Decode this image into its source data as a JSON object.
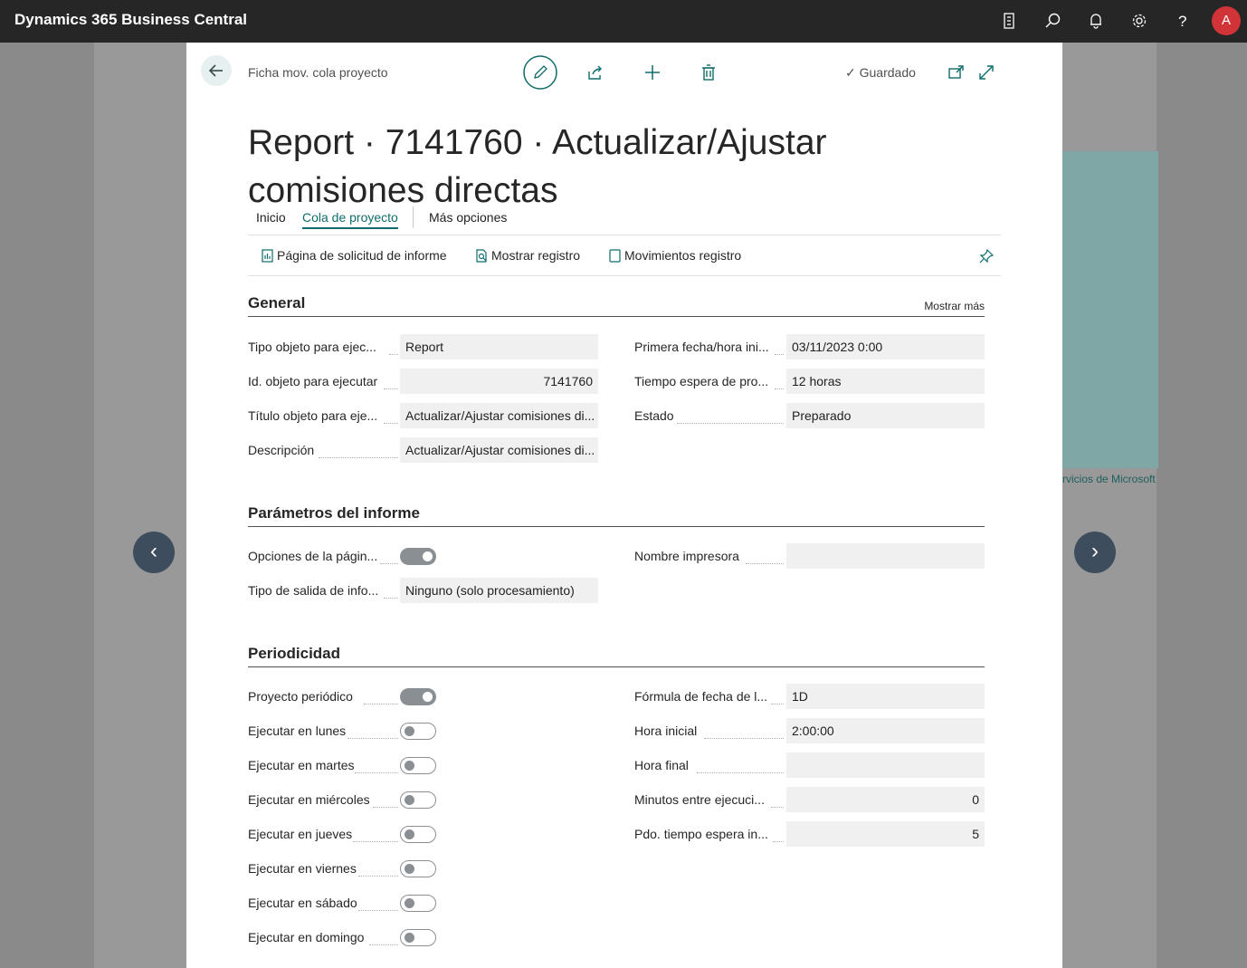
{
  "app": {
    "title": "Dynamics 365 Business Central",
    "avatar_initial": "A"
  },
  "background": {
    "attribution": "rvicios de Microsoft"
  },
  "dialog": {
    "breadcrumb": "Ficha mov. cola proyecto",
    "saved_label": "Guardado",
    "title": "Report · 7141760 · Actualizar/Ajustar comisiones directas",
    "tabs": [
      "Inicio",
      "Cola de proyecto",
      "Más opciones"
    ],
    "active_tab": "Cola de proyecto",
    "actions": [
      "Página de solicitud de informe",
      "Mostrar registro",
      "Movimientos registro"
    ]
  },
  "general": {
    "heading": "General",
    "show_more": "Mostrar más",
    "left": [
      {
        "label": "Tipo objeto para ejec...",
        "value": "Report"
      },
      {
        "label": "Id. objeto para ejecutar",
        "value": "7141760"
      },
      {
        "label": "Título objeto para eje...",
        "value": "Actualizar/Ajustar comisiones di..."
      },
      {
        "label": "Descripción",
        "value": "Actualizar/Ajustar comisiones di..."
      }
    ],
    "right": [
      {
        "label": "Primera fecha/hora ini...",
        "value": "03/11/2023 0:00"
      },
      {
        "label": "Tiempo espera de pro...",
        "value": "12 horas"
      },
      {
        "label": "Estado",
        "value": "Preparado"
      }
    ]
  },
  "report_params": {
    "heading": "Parámetros del informe",
    "options_label": "Opciones de la págin...",
    "options_on": true,
    "output_label": "Tipo de salida de info...",
    "output_value": "Ninguno (solo procesamiento)",
    "printer_label": "Nombre impresora",
    "printer_value": ""
  },
  "periodicity": {
    "heading": "Periodicidad",
    "toggles": [
      {
        "label": "Proyecto periódico",
        "on": true
      },
      {
        "label": "Ejecutar en lunes",
        "on": false
      },
      {
        "label": "Ejecutar en martes",
        "on": false
      },
      {
        "label": "Ejecutar en miércoles",
        "on": false
      },
      {
        "label": "Ejecutar en jueves",
        "on": false
      },
      {
        "label": "Ejecutar en viernes",
        "on": false
      },
      {
        "label": "Ejecutar en sábado",
        "on": false
      },
      {
        "label": "Ejecutar en domingo",
        "on": false
      }
    ],
    "right": [
      {
        "label": "Fórmula de fecha de l...",
        "value": "1D"
      },
      {
        "label": "Hora inicial",
        "value": "2:00:00"
      },
      {
        "label": "Hora final",
        "value": ""
      },
      {
        "label": "Minutos entre ejecuci...",
        "value": "0"
      },
      {
        "label": "Pdo. tiempo espera in...",
        "value": "5"
      }
    ]
  }
}
